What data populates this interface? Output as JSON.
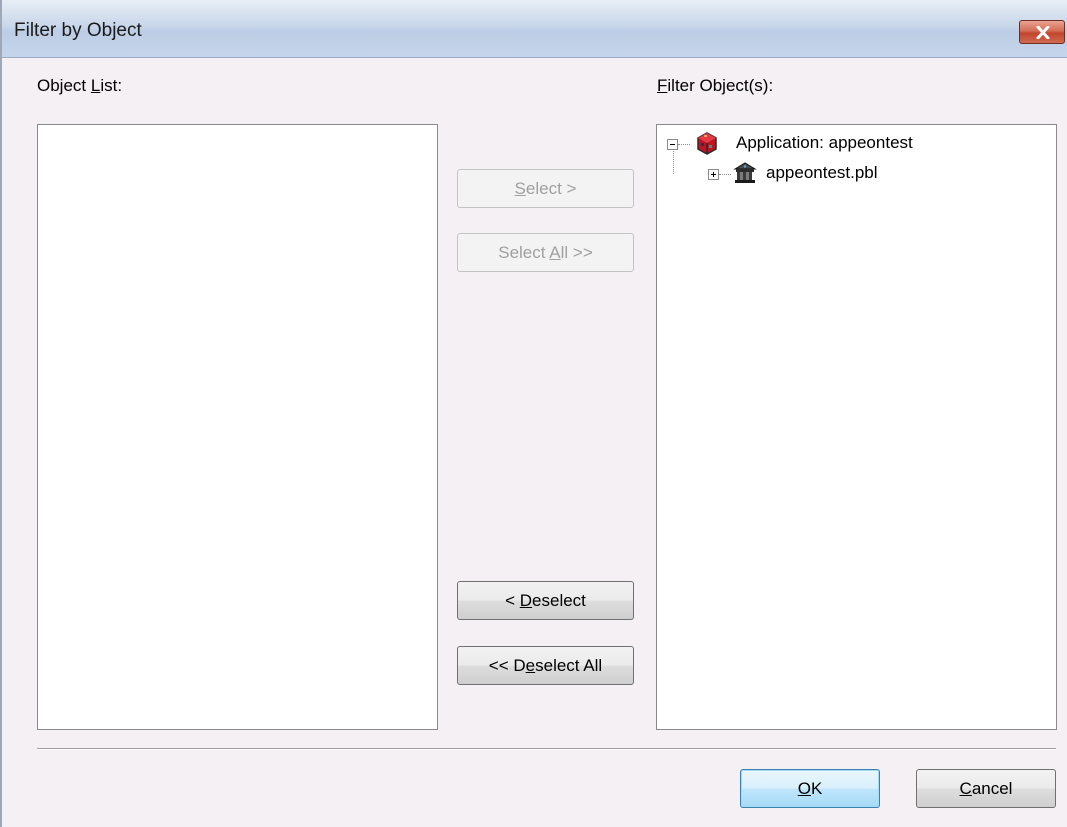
{
  "window": {
    "title": "Filter by Object",
    "close_icon": "close-icon"
  },
  "left_panel": {
    "label_prefix": "Object ",
    "label_accel": "L",
    "label_suffix": "ist:",
    "items": []
  },
  "right_panel": {
    "label_accel": "F",
    "label_suffix": "ilter Object(s):",
    "tree": [
      {
        "label": "Application:  appeontest",
        "icon": "application-icon",
        "expanded": true,
        "children": [
          {
            "label": "appeontest.pbl",
            "icon": "library-icon",
            "expanded": false
          }
        ]
      }
    ]
  },
  "buttons": {
    "select": {
      "pre": "",
      "accel": "S",
      "post": "elect >",
      "enabled": false
    },
    "select_all": {
      "pre": "Select ",
      "accel": "A",
      "post": "ll >>",
      "enabled": false
    },
    "deselect": {
      "pre": "< ",
      "accel": "D",
      "post": "eselect",
      "enabled": true
    },
    "deselect_all": {
      "pre": "<< D",
      "accel": "e",
      "post": "select All",
      "enabled": true
    },
    "ok": {
      "pre": "",
      "accel": "O",
      "post": "K",
      "default": true
    },
    "cancel": {
      "pre": "",
      "accel": "C",
      "post": "ancel"
    }
  },
  "colors": {
    "dialog_bg": "#f4f0f4",
    "titlebar": "#c9d7ea",
    "close_button": "#c2442c",
    "default_button_border": "#3c7fb1"
  }
}
